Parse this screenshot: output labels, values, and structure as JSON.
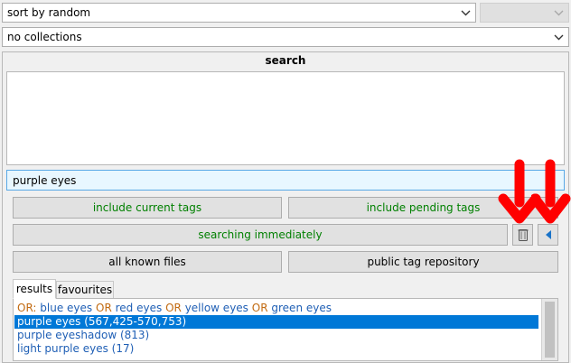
{
  "sort_select": {
    "value": "sort by random"
  },
  "collections_select": {
    "value": "no collections"
  },
  "search_panel": {
    "title": "search",
    "input_value": "purple eyes",
    "include_current_tags": "include current tags",
    "include_pending_tags": "include pending tags",
    "searching_immediately": "searching immediately",
    "file_domain": "all known files",
    "tag_domain": "public tag repository"
  },
  "tabs": [
    {
      "label": "results",
      "active": true
    },
    {
      "label": "favourites",
      "active": false
    }
  ],
  "results": {
    "or_row": {
      "prefix": "OR:",
      "terms": [
        "blue eyes",
        "red eyes",
        "yellow eyes",
        "green eyes"
      ],
      "joiner": "OR"
    },
    "items": [
      {
        "label": "purple eyes (567,425-570,753)",
        "selected": true
      },
      {
        "label": "purple eyeshadow (813)",
        "selected": false
      },
      {
        "label": "light purple eyes (17)",
        "selected": false
      }
    ]
  },
  "colors": {
    "accent_green": "#008000",
    "selection_blue": "#0078d7",
    "tag_blue": "#1f5fb5",
    "or_orange": "#c26b12",
    "annotation_red": "#ff0000"
  },
  "icons": [
    "chevron-down-icon",
    "trash-icon",
    "triangle-left-icon",
    "arrow-down-icon"
  ]
}
